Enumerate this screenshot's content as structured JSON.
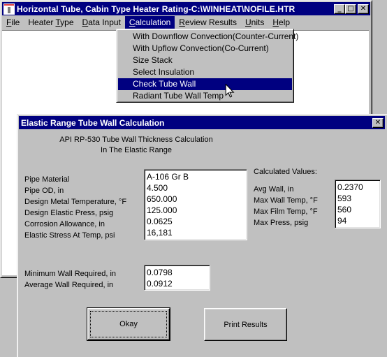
{
  "main_window": {
    "title": "Horizontal Tube, Cabin Type Heater Rating-C:\\WINHEAT\\NOFILE.HTR",
    "app_icon": "heater-icon",
    "controls": {
      "minimize": "_",
      "maximize": "□",
      "close": "✕"
    },
    "menu": [
      {
        "label": "File",
        "mnemonic": "F",
        "rest": "ile",
        "pre": ""
      },
      {
        "label": "Heater Type",
        "pre": "Heater ",
        "mnemonic": "T",
        "rest": "ype"
      },
      {
        "label": "Data Input",
        "pre": "",
        "mnemonic": "D",
        "rest": "ata Input"
      },
      {
        "label": "Calculation",
        "pre": "",
        "mnemonic": "C",
        "rest": "alculation",
        "active": true
      },
      {
        "label": "Review Results",
        "pre": "",
        "mnemonic": "R",
        "rest": "eview Results"
      },
      {
        "label": "Units",
        "pre": "",
        "mnemonic": "U",
        "rest": "nits"
      },
      {
        "label": "Help",
        "pre": "",
        "mnemonic": "H",
        "rest": "elp"
      }
    ]
  },
  "calculation_menu": {
    "items": [
      {
        "label": "With Downflow Convection(Counter-Current)"
      },
      {
        "label": "With Upflow Convection(Co-Current)"
      },
      {
        "label": "Size Stack"
      },
      {
        "label": "Select Insulation"
      },
      {
        "label": "Check Tube Wall",
        "selected": true
      },
      {
        "label": "Radiant Tube Wall Temp"
      }
    ]
  },
  "dialog": {
    "title": "Elastic Range Tube Wall Calculation",
    "close": "✕",
    "heading_line1": "API RP-530 Tube Wall Thickness Calculation",
    "heading_line2": "In The Elastic Range",
    "inputs": {
      "labels": [
        "Pipe Material",
        "Pipe OD, in",
        "Design Metal Temperature, °F",
        "Design Elastic Press, psig",
        "Corrosion Allowance, in",
        "Elastic Stress At Temp, psi"
      ],
      "values": [
        "A-106 Gr B",
        "4.500",
        "650.000",
        "125.000",
        "0.0625",
        "16,181"
      ]
    },
    "calculated": {
      "header": "Calculated Values:",
      "labels": [
        "Avg Wall, in",
        "Max Wall Temp, °F",
        "Max Film Temp, °F",
        "Max Press, psig"
      ],
      "values": [
        "0.2370",
        "593",
        "560",
        "94"
      ]
    },
    "required": {
      "labels": [
        "Minimum Wall Required, in",
        "Average Wall Required, in"
      ],
      "values": [
        "0.0798",
        "0.0912"
      ]
    },
    "buttons": {
      "okay": "Okay",
      "print": "Print Results"
    }
  }
}
